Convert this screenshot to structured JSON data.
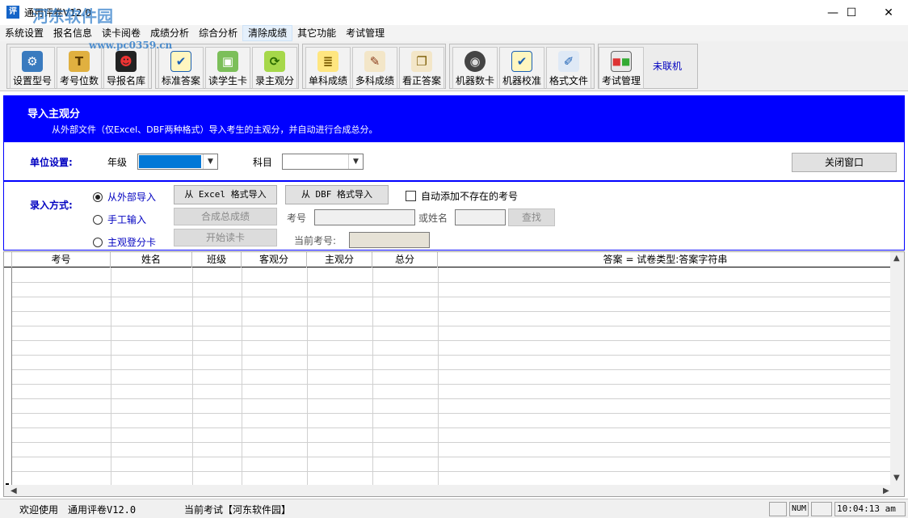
{
  "window": {
    "title": "通用评卷V12.0",
    "watermark": "河东软件园",
    "watermark_url": "www.pc0359.cn",
    "minimize": "—",
    "maximize": "☐",
    "close": "✕"
  },
  "menu": [
    "系统设置",
    "报名信息",
    "读卡阅卷",
    "成绩分析",
    "综合分析",
    "清除成绩",
    "其它功能",
    "考试管理"
  ],
  "toolbar": {
    "buttons": [
      {
        "label": "设置型号",
        "icon": "settings-scanner-icon"
      },
      {
        "label": "考号位数",
        "icon": "hammer-icon"
      },
      {
        "label": "导报名库",
        "icon": "person-icon"
      },
      {
        "label": "标准答案",
        "icon": "checkbox-icon"
      },
      {
        "label": "读学生卡",
        "icon": "card-read-icon"
      },
      {
        "label": "录主观分",
        "icon": "refresh-icon"
      },
      {
        "label": "单科成绩",
        "icon": "document-icon"
      },
      {
        "label": "多科成绩",
        "icon": "pen-paper-icon"
      },
      {
        "label": "看正答案",
        "icon": "pages-icon"
      },
      {
        "label": "机器数卡",
        "icon": "reel-icon"
      },
      {
        "label": "机器校准",
        "icon": "checkbox-icon"
      },
      {
        "label": "格式文件",
        "icon": "pencil-icon"
      },
      {
        "label": "考试管理",
        "icon": "grid-icon"
      }
    ],
    "status": "未联机"
  },
  "info": {
    "title": "导入主观分",
    "desc": "从外部文件（仅Excel、DBF两种格式）导入考生的主观分，并自动进行合成总分。"
  },
  "unit": {
    "label": "单位设置:",
    "grade_label": "年级",
    "grade_value": "",
    "subject_label": "科目",
    "subject_value": "",
    "close_btn": "关闭窗口"
  },
  "mode": {
    "label": "录入方式:",
    "options": [
      "从外部导入",
      "手工输入",
      "主观登分卡"
    ],
    "selected": 0,
    "excel_btn": "从 Excel 格式导入",
    "dbf_btn": "从 DBF 格式导入",
    "auto_add": "自动添加不存在的考号",
    "combine_btn": "合成总成绩",
    "start_btn": "开始读卡",
    "exam_no_label": "考号",
    "or_name_label": "或姓名",
    "find_btn": "查找",
    "current_label": "当前考号:"
  },
  "grid": {
    "columns": [
      "考号",
      "姓名",
      "班级",
      "客观分",
      "主观分",
      "总分",
      "答案 = 试卷类型:答案字符串"
    ]
  },
  "status": {
    "welcome": "欢迎使用",
    "app": "通用评卷V12.0",
    "current_exam": "当前考试【河东软件园】",
    "num": "NUM",
    "time": "10:04:13 am"
  }
}
